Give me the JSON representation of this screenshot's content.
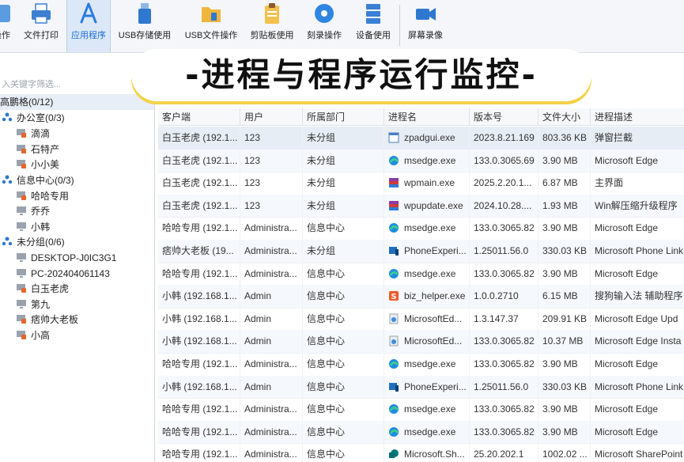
{
  "toolbar": {
    "items": [
      {
        "label": "操作"
      },
      {
        "label": "文件打印"
      },
      {
        "label": "应用程序"
      },
      {
        "label": "USB存储使用"
      },
      {
        "label": "USB文件操作"
      },
      {
        "label": "剪贴板使用"
      },
      {
        "label": "刻录操作"
      },
      {
        "label": "设备使用"
      },
      {
        "label": "屏幕录像"
      }
    ]
  },
  "banner": {
    "title": "-进程与程序运行监控-"
  },
  "sidebar": {
    "search_placeholder": "入关键字筛选...",
    "root": "高鹏格(0/12)",
    "groups": [
      {
        "label": "办公室(0/3)",
        "children": [
          "滴滴",
          "石特产",
          "小小美"
        ]
      },
      {
        "label": "信息中心(0/3)",
        "children": [
          "哈哈专用",
          "乔乔",
          "小韩"
        ]
      },
      {
        "label": "未分组(0/6)",
        "children": [
          "DESKTOP-J0IC3G1",
          "PC-202404061143",
          "白玉老虎",
          "第九",
          "痞帅大老板",
          "小高"
        ]
      }
    ]
  },
  "table": {
    "columns": [
      "客户端",
      "用户",
      "所属部门",
      "进程名",
      "版本号",
      "文件大小",
      "进程描述"
    ],
    "rows": [
      {
        "client": "白玉老虎 (192.1...",
        "user": "123",
        "dept": "未分组",
        "proc": "zpadgui.exe",
        "icon": "window-icon",
        "ver": "2023.8.21.169",
        "size": "803.36 KB",
        "desc": "弹窗拦截"
      },
      {
        "client": "白玉老虎 (192.1...",
        "user": "123",
        "dept": "未分组",
        "proc": "msedge.exe",
        "icon": "edge-icon",
        "ver": "133.0.3065.69",
        "size": "3.90 MB",
        "desc": "Microsoft Edge"
      },
      {
        "client": "白玉老虎 (192.1...",
        "user": "123",
        "dept": "未分组",
        "proc": "wpmain.exe",
        "icon": "winrar-icon",
        "ver": "2025.2.20.1...",
        "size": "6.87 MB",
        "desc": "主界面"
      },
      {
        "client": "白玉老虎 (192.1...",
        "user": "123",
        "dept": "未分组",
        "proc": "wpupdate.exe",
        "icon": "winrar-icon",
        "ver": "2024.10.28....",
        "size": "1.93 MB",
        "desc": "Win解压缩升级程序"
      },
      {
        "client": "哈哈专用 (192.1...",
        "user": "Administra...",
        "dept": "信息中心",
        "proc": "msedge.exe",
        "icon": "edge-icon",
        "ver": "133.0.3065.82",
        "size": "3.90 MB",
        "desc": "Microsoft Edge"
      },
      {
        "client": "痞帅大老板 (19...",
        "user": "Administra...",
        "dept": "未分组",
        "proc": "PhoneExperi...",
        "icon": "phone-icon",
        "ver": "1.25011.56.0",
        "size": "330.03 KB",
        "desc": "Microsoft Phone Link"
      },
      {
        "client": "哈哈专用 (192.1...",
        "user": "Administra...",
        "dept": "信息中心",
        "proc": "msedge.exe",
        "icon": "edge-icon",
        "ver": "133.0.3065.82",
        "size": "3.90 MB",
        "desc": "Microsoft Edge"
      },
      {
        "client": "小韩 (192.168.1...",
        "user": "Admin",
        "dept": "信息中心",
        "proc": "biz_helper.exe",
        "icon": "sogou-icon",
        "ver": "1.0.0.2710",
        "size": "6.15 MB",
        "desc": "搜狗输入法 辅助程序"
      },
      {
        "client": "小韩 (192.168.1...",
        "user": "Admin",
        "dept": "信息中心",
        "proc": "MicrosoftEd...",
        "icon": "installer-icon",
        "ver": "1.3.147.37",
        "size": "209.91 KB",
        "desc": "Microsoft Edge Upd"
      },
      {
        "client": "小韩 (192.168.1...",
        "user": "Admin",
        "dept": "信息中心",
        "proc": "MicrosoftEd...",
        "icon": "installer-icon",
        "ver": "133.0.3065.82",
        "size": "10.37 MB",
        "desc": "Microsoft Edge Insta"
      },
      {
        "client": "哈哈专用 (192.1...",
        "user": "Administra...",
        "dept": "信息中心",
        "proc": "msedge.exe",
        "icon": "edge-icon",
        "ver": "133.0.3065.82",
        "size": "3.90 MB",
        "desc": "Microsoft Edge"
      },
      {
        "client": "小韩 (192.168.1...",
        "user": "Admin",
        "dept": "信息中心",
        "proc": "PhoneExperi...",
        "icon": "phone-icon",
        "ver": "1.25011.56.0",
        "size": "330.03 KB",
        "desc": "Microsoft Phone Link"
      },
      {
        "client": "哈哈专用 (192.1...",
        "user": "Administra...",
        "dept": "信息中心",
        "proc": "msedge.exe",
        "icon": "edge-icon",
        "ver": "133.0.3065.82",
        "size": "3.90 MB",
        "desc": "Microsoft Edge"
      },
      {
        "client": "哈哈专用 (192.1...",
        "user": "Administra...",
        "dept": "信息中心",
        "proc": "msedge.exe",
        "icon": "edge-icon",
        "ver": "133.0.3065.82",
        "size": "3.90 MB",
        "desc": "Microsoft Edge"
      },
      {
        "client": "哈哈专用 (192.1...",
        "user": "Administra...",
        "dept": "信息中心",
        "proc": "Microsoft.Sh...",
        "icon": "sharepoint-icon",
        "ver": "25.20.202.1",
        "size": "1002.02 ...",
        "desc": "Microsoft SharePoint"
      }
    ]
  }
}
